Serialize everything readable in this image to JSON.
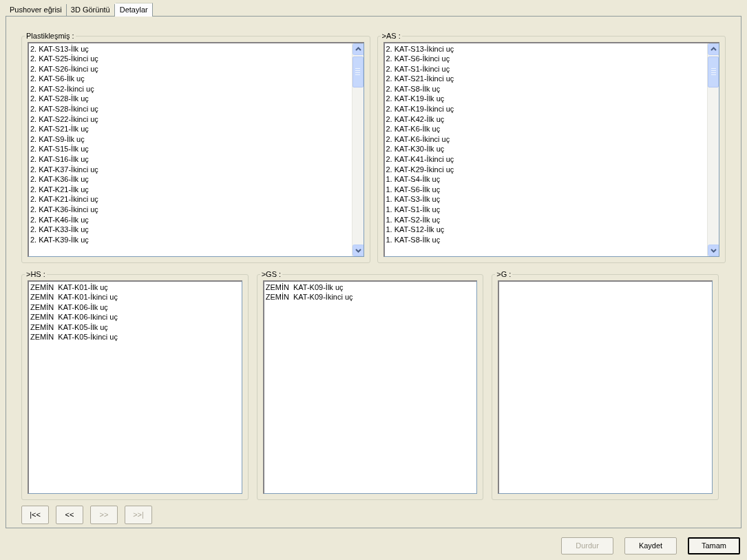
{
  "tabs": [
    {
      "label": "Pushover eğrisi",
      "selected": false
    },
    {
      "label": "3D Görüntü",
      "selected": false
    },
    {
      "label": "Detaylar",
      "selected": true
    }
  ],
  "top_groups": [
    {
      "title": "Plastikleşmiş :",
      "scrollbar": true,
      "items": [
        "2. KAT-S13-İlk uç",
        "2. KAT-S25-İkinci uç",
        "2. KAT-S26-İkinci uç",
        "2. KAT-S6-İlk uç",
        "2. KAT-S2-İkinci uç",
        "2. KAT-S28-İlk uç",
        "2. KAT-S28-İkinci uç",
        "2. KAT-S22-İkinci uç",
        "2. KAT-S21-İlk uç",
        "2. KAT-S9-İlk uç",
        "2. KAT-S15-İlk uç",
        "2. KAT-S16-İlk uç",
        "2. KAT-K37-İkinci uç",
        "2. KAT-K36-İlk uç",
        "2. KAT-K21-İlk uç",
        "2. KAT-K21-İkinci uç",
        "2. KAT-K36-İkinci uç",
        "2. KAT-K46-İlk uç",
        "2. KAT-K33-İlk uç",
        "2. KAT-K39-İlk uç"
      ]
    },
    {
      "title": ">AS :",
      "scrollbar": true,
      "items": [
        "2. KAT-S13-İkinci uç",
        "2. KAT-S6-İkinci uç",
        "2. KAT-S1-İkinci uç",
        "2. KAT-S21-İkinci uç",
        "2. KAT-S8-İlk uç",
        "2. KAT-K19-İlk uç",
        "2. KAT-K19-İkinci uç",
        "2. KAT-K42-İlk uç",
        "2. KAT-K6-İlk uç",
        "2. KAT-K6-İkinci uç",
        "2. KAT-K30-İlk uç",
        "2. KAT-K41-İkinci uç",
        "2. KAT-K29-İkinci uç",
        "1. KAT-S4-İlk uç",
        "1. KAT-S6-İlk uç",
        "1. KAT-S3-İlk uç",
        "1. KAT-S1-İlk uç",
        "1. KAT-S2-İlk uç",
        "1. KAT-S12-İlk uç",
        "1. KAT-S8-İlk uç"
      ]
    }
  ],
  "bottom_groups": [
    {
      "title": ">HS :",
      "scrollbar": false,
      "items": [
        "ZEMİN  KAT-K01-İlk uç",
        "ZEMİN  KAT-K01-İkinci uç",
        "ZEMİN  KAT-K06-İlk uç",
        "ZEMİN  KAT-K06-Ikinci uç",
        "ZEMİN  KAT-K05-İlk uç",
        "ZEMİN  KAT-K05-İkinci uç"
      ]
    },
    {
      "title": ">GS :",
      "scrollbar": false,
      "items": [
        "ZEMİN  KAT-K09-İlk uç",
        "ZEMİN  KAT-K09-İkinci uç"
      ]
    },
    {
      "title": ">G :",
      "scrollbar": false
    }
  ],
  "nav_buttons": [
    {
      "label": "|<<",
      "disabled": false
    },
    {
      "label": "<<",
      "disabled": false
    },
    {
      "label": ">>",
      "disabled": true
    },
    {
      "label": ">>|",
      "disabled": true
    }
  ],
  "footer_buttons": [
    {
      "label": "Durdur",
      "disabled": true,
      "default": false
    },
    {
      "label": "Kaydet",
      "disabled": false,
      "default": false
    },
    {
      "label": "Tamam",
      "disabled": false,
      "default": true
    }
  ]
}
